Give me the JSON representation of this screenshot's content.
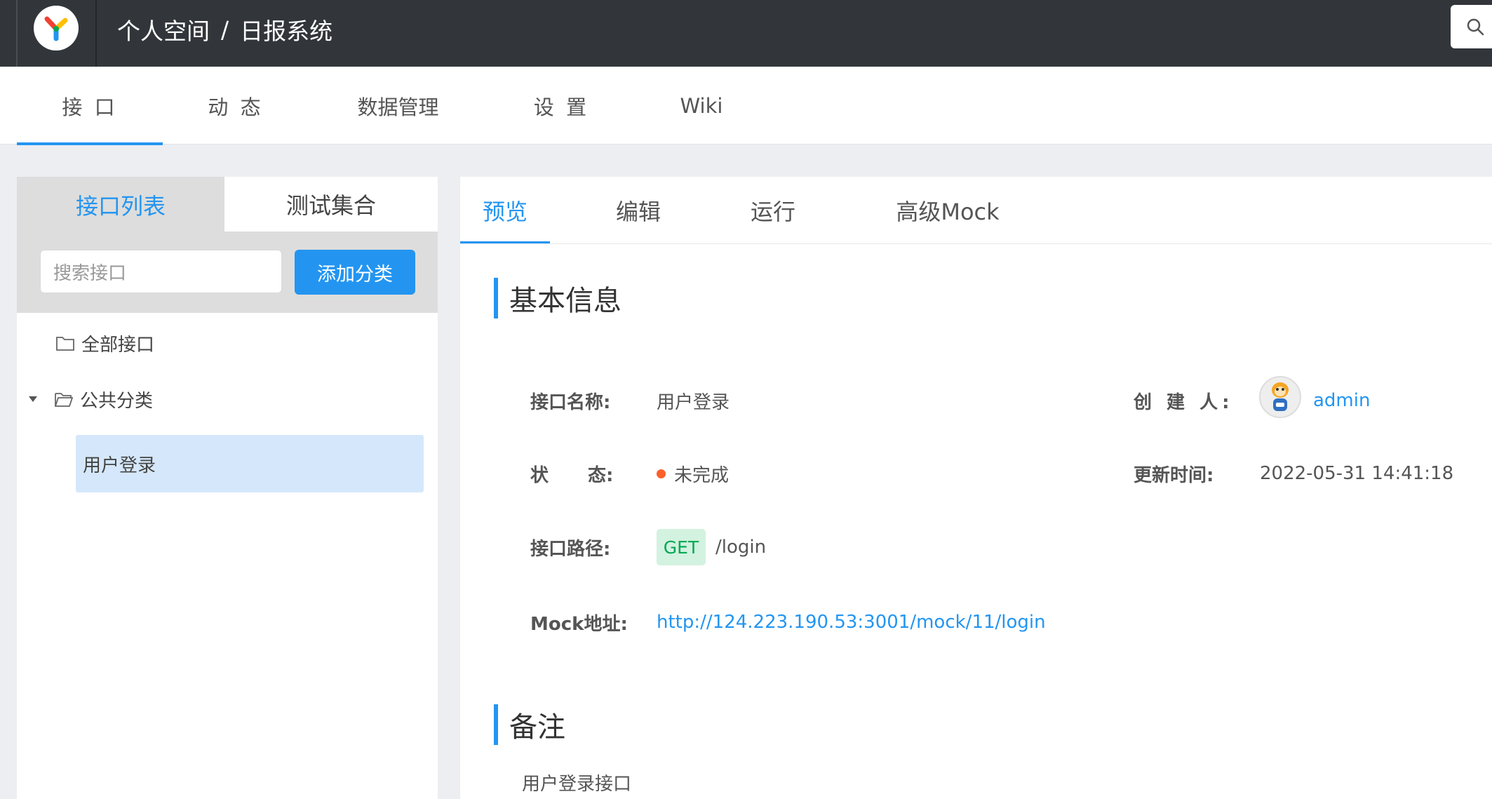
{
  "header": {
    "breadcrumb": [
      "个人空间",
      "日报系统"
    ],
    "separator": "/",
    "logo_icon": "yapi-logo-icon",
    "search_icon": "search-icon"
  },
  "nav": {
    "tabs": [
      {
        "label": "接 口",
        "active": true
      },
      {
        "label": "动 态",
        "active": false
      },
      {
        "label": "数据管理",
        "active": false
      },
      {
        "label": "设 置",
        "active": false
      },
      {
        "label": "Wiki",
        "active": false
      }
    ]
  },
  "left": {
    "tabs": [
      "接口列表",
      "测试集合"
    ],
    "active_tab": "接口列表",
    "search_placeholder": "搜索接口",
    "add_button": "添加分类",
    "tree": {
      "all": "全部接口",
      "category": "公共分类",
      "selected_item": "用户登录"
    }
  },
  "right": {
    "tabs": [
      "预览",
      "编辑",
      "运行",
      "高级Mock"
    ],
    "active_tab": "预览",
    "basic_info_title": "基本信息",
    "fields": {
      "name_label": "接口名称:",
      "name_value": "用户登录",
      "creator_label": "创 建 人:",
      "creator_value": "admin",
      "status_label_1": "状",
      "status_label_2": "态:",
      "status_value": "未完成",
      "updated_label": "更新时间:",
      "updated_value": "2022-05-31 14:41:18",
      "path_label": "接口路径:",
      "method": "GET",
      "path_value": "/login",
      "mock_label": "Mock地址:",
      "mock_value": "http://124.223.190.53:3001/mock/11/login"
    },
    "remark_title": "备注",
    "remark_value": "用户登录接口"
  },
  "colors": {
    "accent": "#2395f1",
    "header_bg": "#32363a",
    "status_dot": "#fd5f2a",
    "get_badge_bg": "#d3f2e0",
    "get_badge_text": "#00a854"
  }
}
